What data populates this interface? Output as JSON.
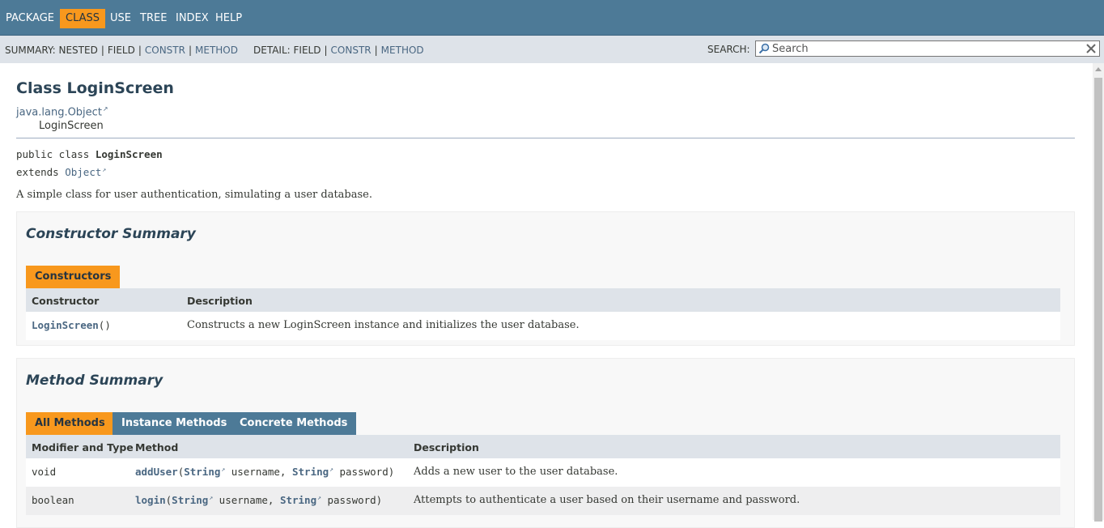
{
  "nav": {
    "items": [
      "PACKAGE",
      "CLASS",
      "USE",
      "TREE",
      "INDEX",
      "HELP"
    ],
    "active": "CLASS"
  },
  "subnav": {
    "summary_label": "SUMMARY:",
    "summary_nested": "NESTED",
    "summary_field": "FIELD",
    "summary_constr": "CONSTR",
    "summary_method": "METHOD",
    "detail_label": "DETAIL:",
    "detail_field": "FIELD",
    "detail_constr": "CONSTR",
    "detail_method": "METHOD",
    "separator": "|"
  },
  "search": {
    "label": "SEARCH:",
    "placeholder": "Search",
    "value": ""
  },
  "page": {
    "title": "Class LoginScreen",
    "inheritance_parent": "java.lang.Object",
    "inheritance_child": "LoginScreen",
    "sig_modifiers": "public class",
    "sig_name": "LoginScreen",
    "sig_extends": "extends",
    "sig_super": "Object",
    "description": "A simple class for user authentication, simulating a user database."
  },
  "constructor_summary": {
    "title": "Constructor Summary",
    "tab": "Constructors",
    "col_constructor": "Constructor",
    "col_description": "Description",
    "rows": [
      {
        "name": "LoginScreen",
        "params": "()",
        "description": "Constructs a new LoginScreen instance and initializes the user database."
      }
    ]
  },
  "method_summary": {
    "title": "Method Summary",
    "tabs": [
      "All Methods",
      "Instance Methods",
      "Concrete Methods"
    ],
    "active_tab": "All Methods",
    "col_modifier": "Modifier and Type",
    "col_method": "Method",
    "col_description": "Description",
    "rows": [
      {
        "type": "void",
        "name": "addUser",
        "open": "(",
        "p1_type": "String",
        "p1_name": " username, ",
        "p2_type": "String",
        "p2_name": " password)",
        "description": "Adds a new user to the user database."
      },
      {
        "type": "boolean",
        "name": "login",
        "open": "(",
        "p1_type": "String",
        "p1_name": " username, ",
        "p2_type": "String",
        "p2_name": " password)",
        "description": "Attempts to authenticate a user based on their username and password."
      }
    ]
  },
  "colors": {
    "nav_bg": "#4d7a97",
    "active_tab": "#f8981d",
    "subnav_bg": "#dee3e9",
    "link": "#4a6782"
  }
}
